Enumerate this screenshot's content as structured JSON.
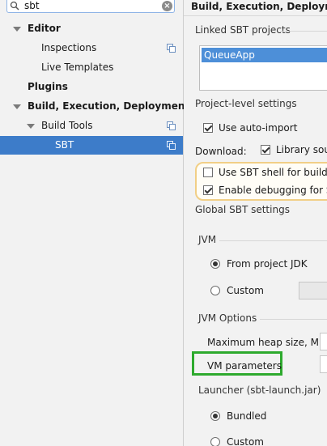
{
  "search": {
    "value": "sbt"
  },
  "tree": {
    "editor": "Editor",
    "inspections": "Inspections",
    "live_templates": "Live Templates",
    "plugins": "Plugins",
    "build": "Build, Execution, Deployment",
    "build_tools": "Build Tools",
    "sbt": "SBT"
  },
  "panel": {
    "header": "Build, Execution, Deployment",
    "linked_projects_label": "Linked SBT projects",
    "project_item": "QueueApp",
    "project_level_label": "Project-level settings",
    "use_auto_import": "Use auto-import",
    "download_label": "Download:",
    "library_sources": "Library sour",
    "use_sbt_shell": "Use SBT shell for build and",
    "enable_debugging": "Enable debugging for SBT",
    "global_label": "Global SBT settings",
    "jvm_label": "JVM",
    "from_project_jdk": "From project JDK",
    "custom": "Custom",
    "jvm_options_label": "JVM Options",
    "max_heap": "Maximum heap size, MB",
    "vm_parameters": "VM parameters",
    "launcher_label": "Launcher (sbt-launch.jar)",
    "bundled": "Bundled",
    "custom2": "Custom"
  },
  "colors": {
    "selection": "#3d7cc9",
    "highlight_green": "#2eaa2e",
    "highlight_yellow": "#f1cf86"
  }
}
